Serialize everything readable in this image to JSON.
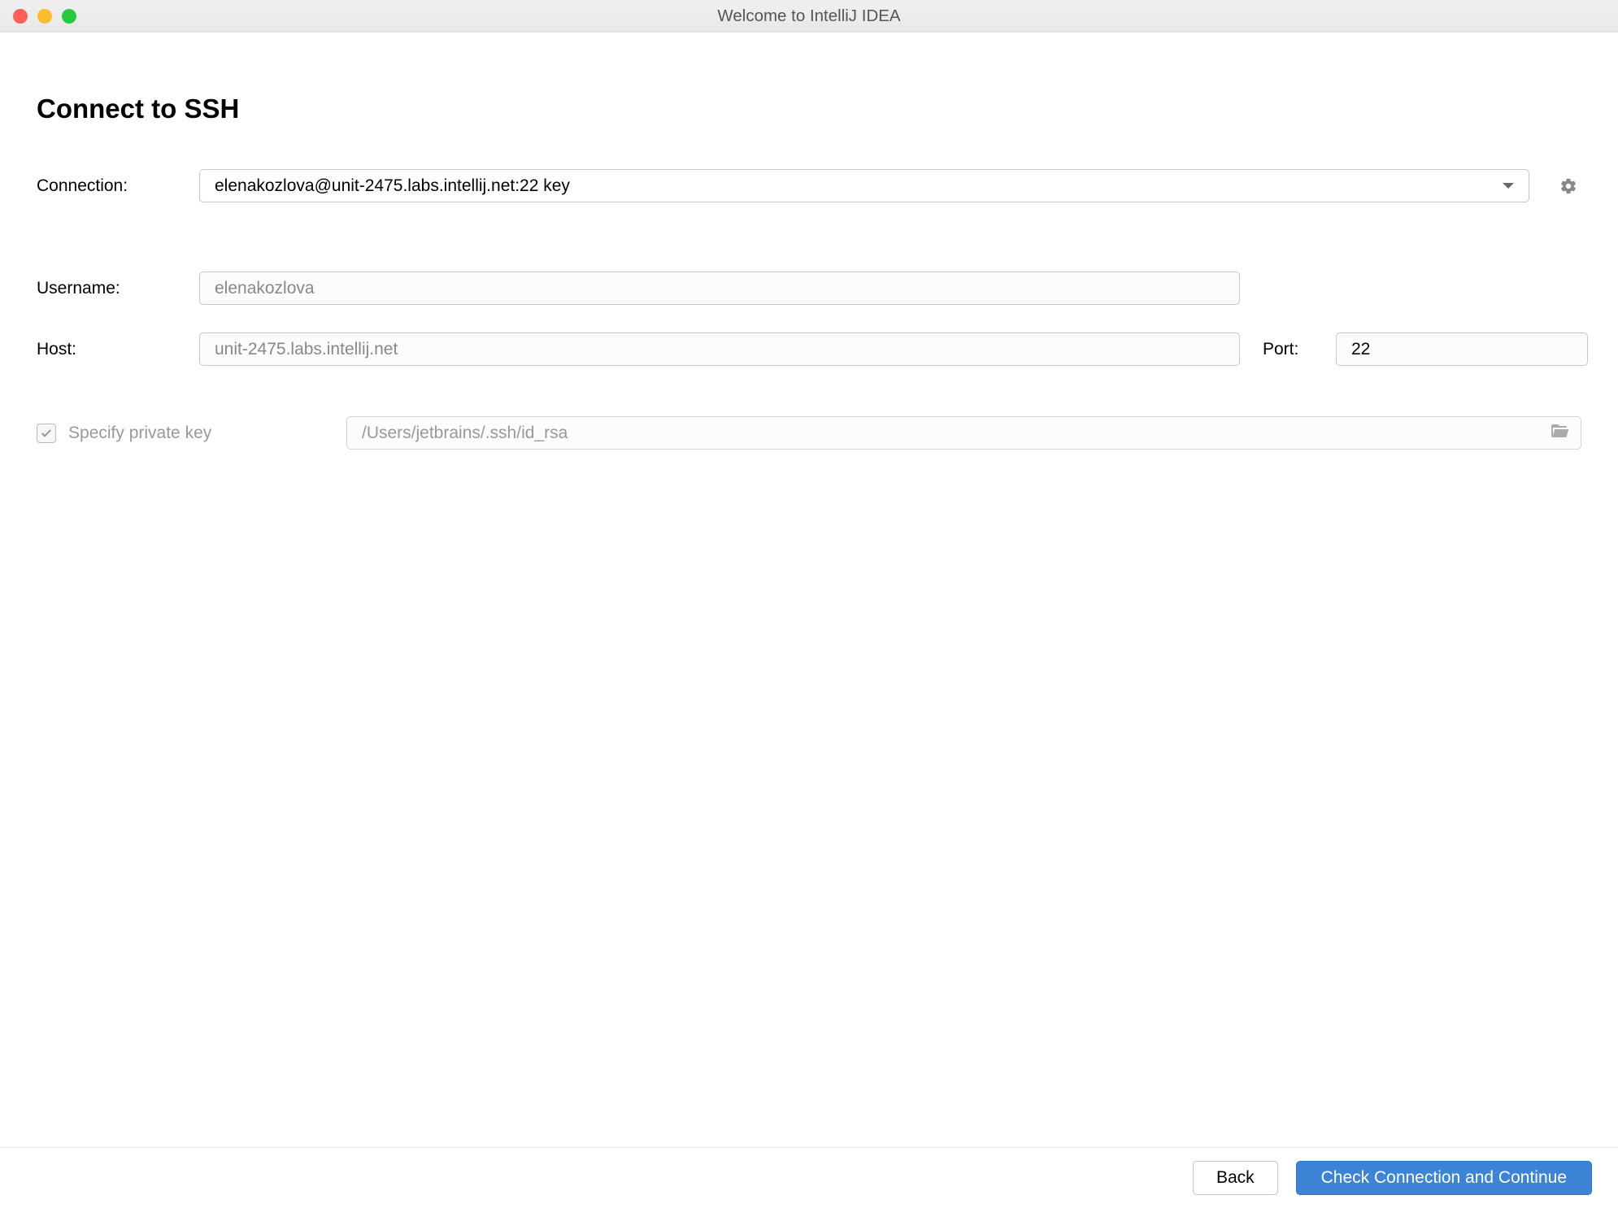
{
  "titlebar": {
    "title": "Welcome to IntelliJ IDEA"
  },
  "page": {
    "title": "Connect to SSH"
  },
  "connection": {
    "label": "Connection:",
    "value": "elenakozlova@unit-2475.labs.intellij.net:22 key"
  },
  "username": {
    "label": "Username:",
    "placeholder": "elenakozlova"
  },
  "host": {
    "label": "Host:",
    "placeholder": "unit-2475.labs.intellij.net"
  },
  "port": {
    "label": "Port:",
    "value": "22"
  },
  "privatekey": {
    "label": "Specify private key",
    "path": "/Users/jetbrains/.ssh/id_rsa",
    "checked": true
  },
  "footer": {
    "back": "Back",
    "continue": "Check Connection and Continue"
  }
}
